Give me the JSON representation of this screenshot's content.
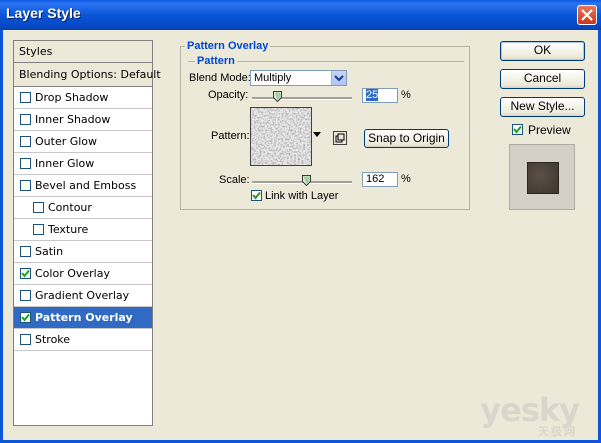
{
  "window": {
    "title": "Layer Style"
  },
  "styles_list": {
    "header": "Styles",
    "blending_options": "Blending Options: Default",
    "items": [
      {
        "label": "Drop Shadow",
        "checked": false,
        "indent": false,
        "selected": false
      },
      {
        "label": "Inner Shadow",
        "checked": false,
        "indent": false,
        "selected": false
      },
      {
        "label": "Outer Glow",
        "checked": false,
        "indent": false,
        "selected": false
      },
      {
        "label": "Inner Glow",
        "checked": false,
        "indent": false,
        "selected": false
      },
      {
        "label": "Bevel and Emboss",
        "checked": false,
        "indent": false,
        "selected": false
      },
      {
        "label": "Contour",
        "checked": false,
        "indent": true,
        "selected": false
      },
      {
        "label": "Texture",
        "checked": false,
        "indent": true,
        "selected": false
      },
      {
        "label": "Satin",
        "checked": false,
        "indent": false,
        "selected": false
      },
      {
        "label": "Color Overlay",
        "checked": true,
        "indent": false,
        "selected": false
      },
      {
        "label": "Gradient Overlay",
        "checked": false,
        "indent": false,
        "selected": false
      },
      {
        "label": "Pattern Overlay",
        "checked": true,
        "indent": false,
        "selected": true
      },
      {
        "label": "Stroke",
        "checked": false,
        "indent": false,
        "selected": false
      }
    ]
  },
  "panel": {
    "group_title": "Pattern Overlay",
    "subgroup_title": "Pattern",
    "blend_mode_label": "Blend Mode:",
    "blend_mode_value": "Multiply",
    "opacity_label": "Opacity:",
    "opacity_value": "25",
    "opacity_unit": "%",
    "opacity_fraction": 0.25,
    "pattern_label": "Pattern:",
    "snap_button": "Snap to Origin",
    "scale_label": "Scale:",
    "scale_value": "162",
    "scale_unit": "%",
    "link_label": "Link with Layer",
    "link_checked": true
  },
  "buttons": {
    "ok": "OK",
    "cancel": "Cancel",
    "new_style": "New Style...",
    "preview_label": "Preview",
    "preview_checked": true
  },
  "watermark": {
    "main": "yesky",
    "sub": "天极网"
  },
  "colors": {
    "title_bar": "#0a55d8",
    "selection": "#316ac5",
    "legend": "#0046d5",
    "dialog_bg": "#ece9d8"
  }
}
